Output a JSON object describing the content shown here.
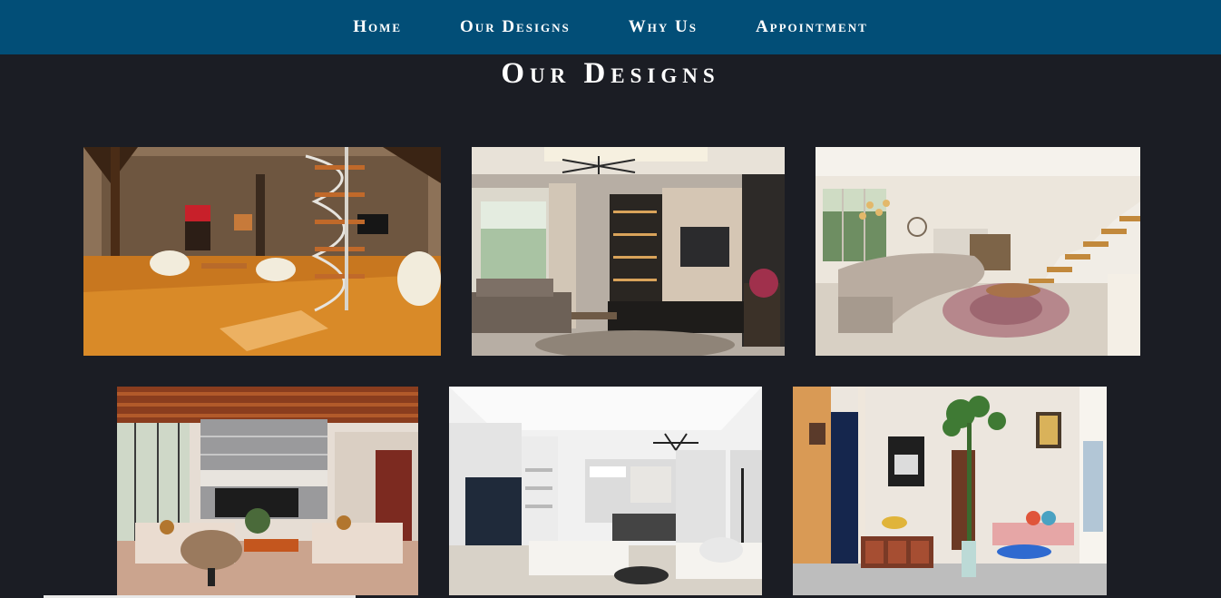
{
  "nav": {
    "items": [
      {
        "label": "Home"
      },
      {
        "label": "Our Designs"
      },
      {
        "label": "Why Us"
      },
      {
        "label": "Appointment"
      }
    ]
  },
  "designs": {
    "title": "Our Designs"
  },
  "colors": {
    "navbar": "#024e77",
    "background": "#1b1d24",
    "text": "#ffffff"
  }
}
